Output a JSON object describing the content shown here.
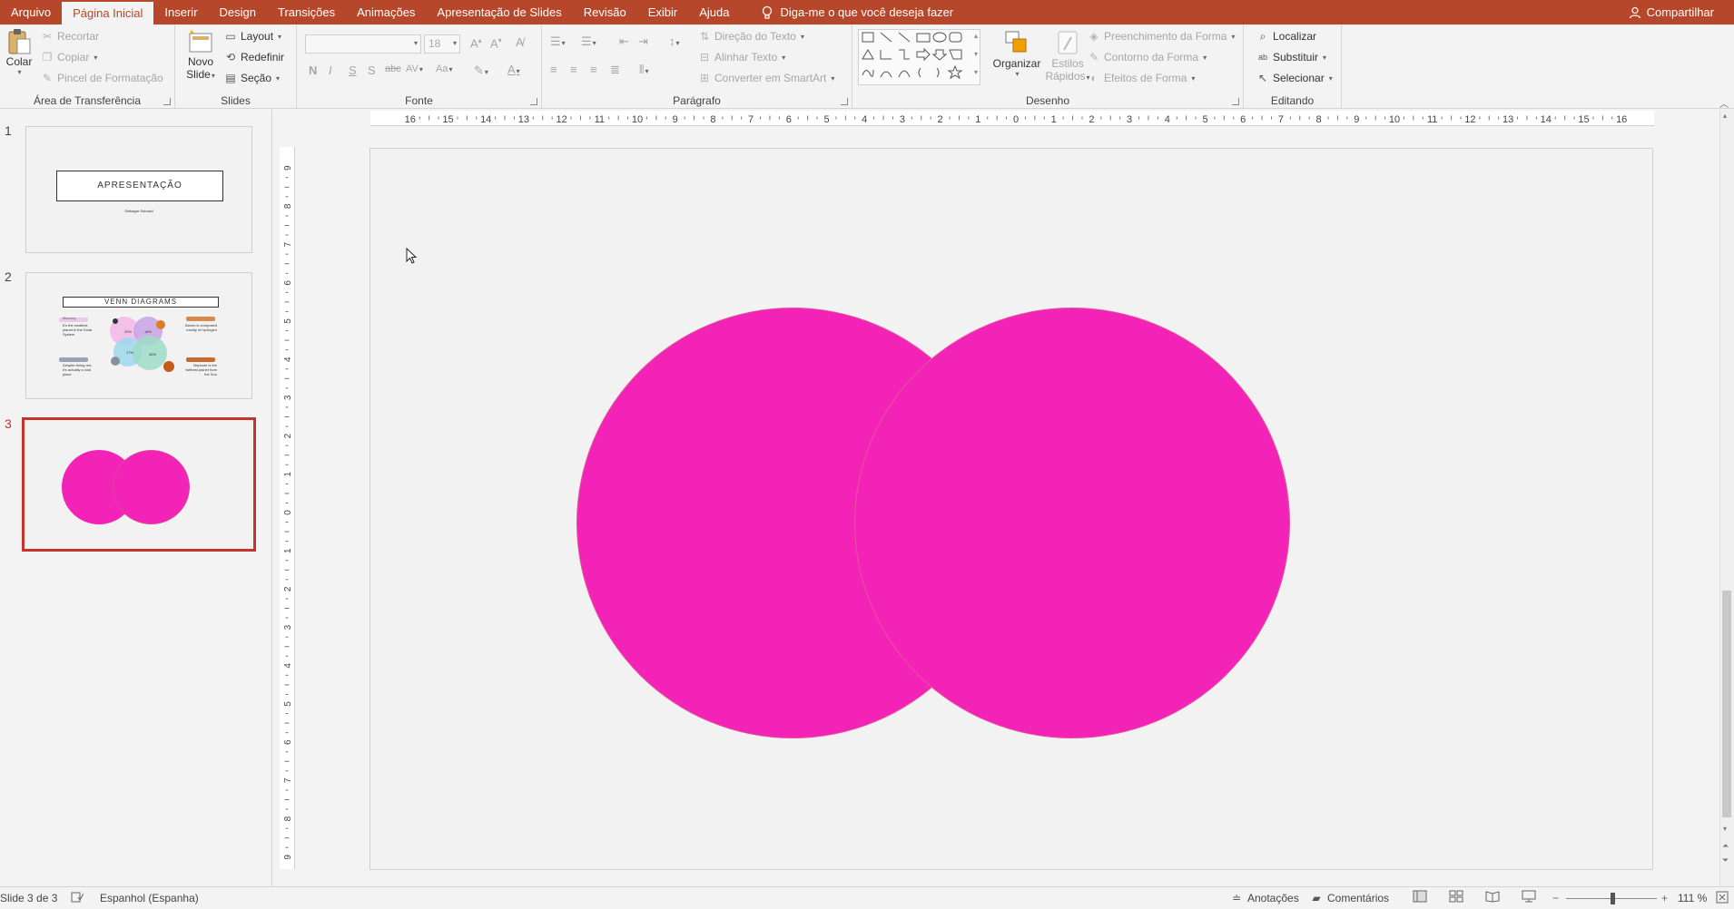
{
  "menu": {
    "tabs": [
      "Arquivo",
      "Página Inicial",
      "Inserir",
      "Design",
      "Transições",
      "Animações",
      "Apresentação de Slides",
      "Revisão",
      "Exibir",
      "Ajuda"
    ],
    "active_index": 1,
    "tell_me": "Diga-me o que você deseja fazer",
    "share": "Compartilhar"
  },
  "ribbon": {
    "clipboard": {
      "label": "Área de Transferência",
      "paste": "Colar",
      "cut": "Recortar",
      "copy": "Copiar",
      "format_painter": "Pincel de Formatação"
    },
    "slides": {
      "label": "Slides",
      "new_slide_1": "Novo",
      "new_slide_2": "Slide",
      "layout": "Layout",
      "reset": "Redefinir",
      "section": "Seção"
    },
    "font": {
      "label": "Fonte",
      "size": "18",
      "bold": "N",
      "italic": "I",
      "underline": "S",
      "shadow": "S",
      "strike": "abc",
      "spacing": "AV",
      "case": "Aa",
      "color": "A"
    },
    "paragraph": {
      "label": "Parágrafo",
      "text_direction": "Direção do Texto",
      "align_text": "Alinhar Texto",
      "smartart": "Converter em SmartArt"
    },
    "drawing": {
      "label": "Desenho",
      "arrange": "Organizar",
      "quick_styles_1": "Estilos",
      "quick_styles_2": "Rápidos",
      "shape_fill": "Preenchimento da Forma",
      "shape_outline": "Contorno da Forma",
      "shape_effects": "Efeitos de Forma"
    },
    "editing": {
      "label": "Editando",
      "find": "Localizar",
      "replace": "Substituir",
      "select": "Selecionar"
    }
  },
  "rulers": {
    "h_left": [
      "16",
      "15",
      "14",
      "13",
      "12",
      "11",
      "10",
      "9",
      "8",
      "7",
      "6",
      "5",
      "4",
      "3",
      "2",
      "1"
    ],
    "h_right": [
      "1",
      "2",
      "3",
      "4",
      "5",
      "6",
      "7",
      "8",
      "9",
      "10",
      "11",
      "12",
      "13",
      "14",
      "15",
      "16"
    ],
    "v_top": [
      "9",
      "8",
      "7",
      "6",
      "5",
      "4",
      "3",
      "2",
      "1"
    ],
    "v_bottom": [
      "1",
      "2",
      "3",
      "4",
      "5",
      "6",
      "7",
      "8",
      "9"
    ],
    "zero": "0"
  },
  "thumbnails": {
    "slide1": {
      "num": "1",
      "title": "APRESENTAÇÃO",
      "subtitle": "Sinbagar Sobrasil"
    },
    "slide2": {
      "num": "2",
      "title": "VENN DIAGRAMS",
      "t1": "It's the smallest planet in the Solar System",
      "t2": "Saturn is composed mostly of hydrogen",
      "t3": "Despite being red, it's actually a cold place",
      "t4": "Neptune is the farthest planet from the Sun",
      "p1": "20%",
      "p2": "18%",
      "p3": "17%",
      "p4": "45%",
      "label1": "Mercury"
    },
    "slide3": {
      "num": "3"
    }
  },
  "slide": {
    "circle_color": "#f223b6"
  },
  "status": {
    "slide_info": "Slide 3 de 3",
    "language": "Espanhol (Espanha)",
    "notes": "Anotações",
    "comments": "Comentários",
    "zoom": "111 %"
  }
}
